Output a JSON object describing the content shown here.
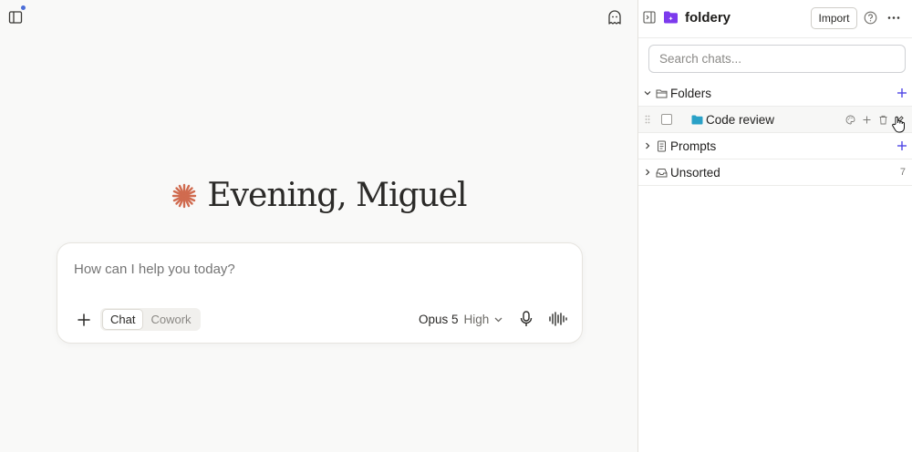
{
  "main": {
    "greeting": "Evening, Miguel",
    "composer": {
      "placeholder": "How can I help you today?",
      "modes": [
        "Chat",
        "Cowork"
      ],
      "active_mode": "Chat",
      "model": "Opus 5",
      "effort": "High"
    }
  },
  "panel": {
    "brand": "foldery",
    "import_label": "Import",
    "search_placeholder": "Search chats...",
    "sections": {
      "folders": "Folders",
      "folder_item": "Code review",
      "prompts": "Prompts",
      "unsorted": "Unsorted",
      "unsorted_count": "7"
    }
  },
  "colors": {
    "accent": "#4f46e5",
    "brand_icon": "#7c3aed",
    "folder_icon": "#2aa1c7",
    "spark": "#d06b4f"
  },
  "icons": [
    "sidebar-icon",
    "ghost-icon",
    "spark-icon",
    "plus-icon",
    "mic-icon",
    "voice-wave-icon",
    "collapse-panel-icon",
    "brand-folder-icon",
    "help-icon",
    "more-icon",
    "chevron-icon",
    "folder-outline-icon",
    "document-icon",
    "inbox-icon",
    "drag-handle-icon",
    "palette-icon",
    "trash-icon",
    "edit-icon"
  ]
}
